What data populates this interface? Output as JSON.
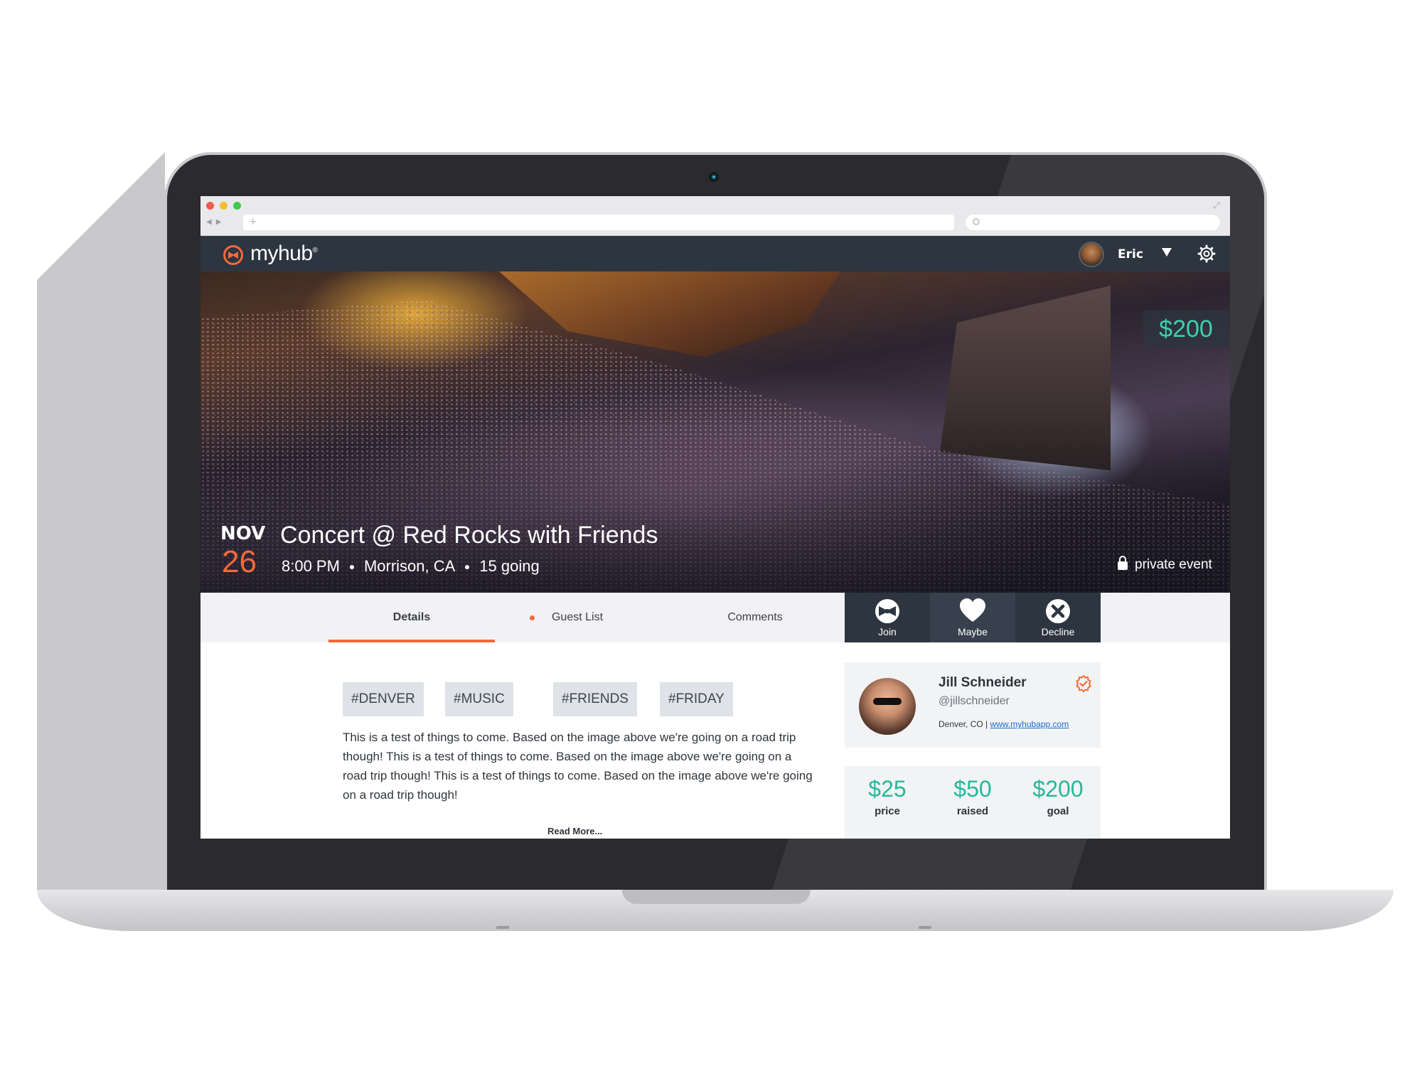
{
  "app": {
    "logo_text": "myhub",
    "logo_mark": "®"
  },
  "header": {
    "user_name": "Eric"
  },
  "hero": {
    "price_badge": "$200",
    "date_month": "NOV",
    "date_day": "26",
    "title": "Concert @ Red Rocks with Friends",
    "time": "8:00 PM",
    "location": "Morrison, CA",
    "going": "15 going",
    "privacy_label": "private event"
  },
  "tabs": {
    "details": "Details",
    "guest_list": "Guest List",
    "comments": "Comments"
  },
  "rsvp": {
    "join": "Join",
    "maybe": "Maybe",
    "decline": "Decline"
  },
  "tags": [
    "#DENVER",
    "#MUSIC",
    "#FRIENDS",
    "#FRIDAY"
  ],
  "description": "This is a test of things to come. Based on the image above we're going on a road trip though! This is a test of things to come. Based on the image above we're going on a road trip though! This is a test of things to come. Based on the image above we're going on a road trip though!",
  "read_more": "Read More...",
  "profile": {
    "name": "Jill Schneider",
    "handle": "@jillschneider",
    "location": "Denver, CO | ",
    "link": "www.myhubapp.com"
  },
  "stats": [
    {
      "value": "$25",
      "label": "price"
    },
    {
      "value": "$50",
      "label": "raised"
    },
    {
      "value": "$200",
      "label": "goal"
    }
  ],
  "colors": {
    "accent": "#f26a3b",
    "money": "#25b89a",
    "header": "#2d3540"
  },
  "icons": {
    "logo": "bowtie-logo-icon",
    "settings": "gear-icon",
    "join": "bowtie-icon",
    "maybe": "heart-icon",
    "decline": "close-circle-icon",
    "verified": "verified-badge-icon",
    "privacy": "lock-icon"
  }
}
